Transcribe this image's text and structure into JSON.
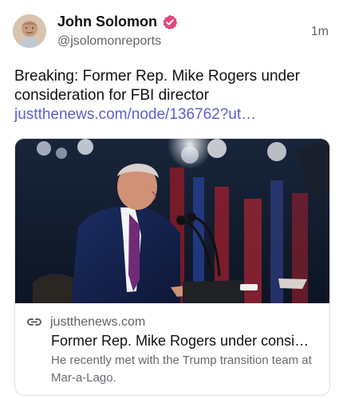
{
  "author": {
    "name": "John Solomon",
    "handle": "@jsolomonreports",
    "verified_color": "#e0467c"
  },
  "post": {
    "time": "1m",
    "text": "Breaking: Former Rep. Mike Rogers under consideration for FBI director",
    "link": "justthenews.com/node/136762?ut…",
    "link_color": "#5b5fd1"
  },
  "card": {
    "domain": "justthenews.com",
    "title": "Former Rep. Mike Rogers under consi…",
    "description": "He recently met with the Trump transition team at Mar-a-Lago.",
    "link_icon": "link-icon",
    "image_icon": "article-photo"
  }
}
